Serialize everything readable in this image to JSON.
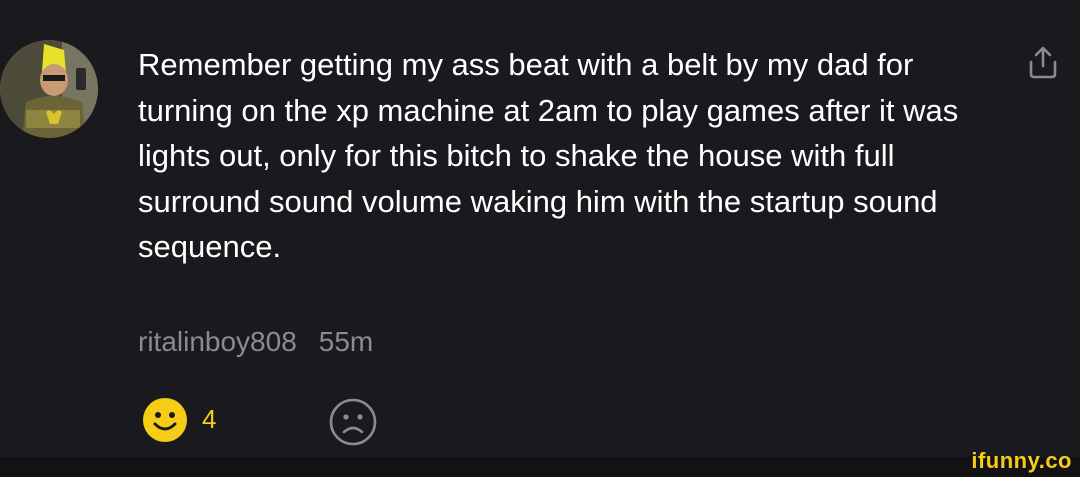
{
  "comment": {
    "text": "Remember getting my ass beat with a belt by my dad for turning on the xp machine at 2am to play games after it was lights out, only for this bitch to shake the house with full surround sound volume waking him with the startup sound sequence.",
    "username": "ritalinboy808",
    "time": "55m"
  },
  "reactions": {
    "smile_count": "4"
  },
  "icons": {
    "share": "share-icon",
    "smile": "smile-icon",
    "frown": "frown-icon"
  },
  "colors": {
    "background": "#1a1a1e",
    "text": "#ffffff",
    "muted": "#8a8a90",
    "accent": "#f5cc16"
  },
  "watermark": "ifunny.co"
}
